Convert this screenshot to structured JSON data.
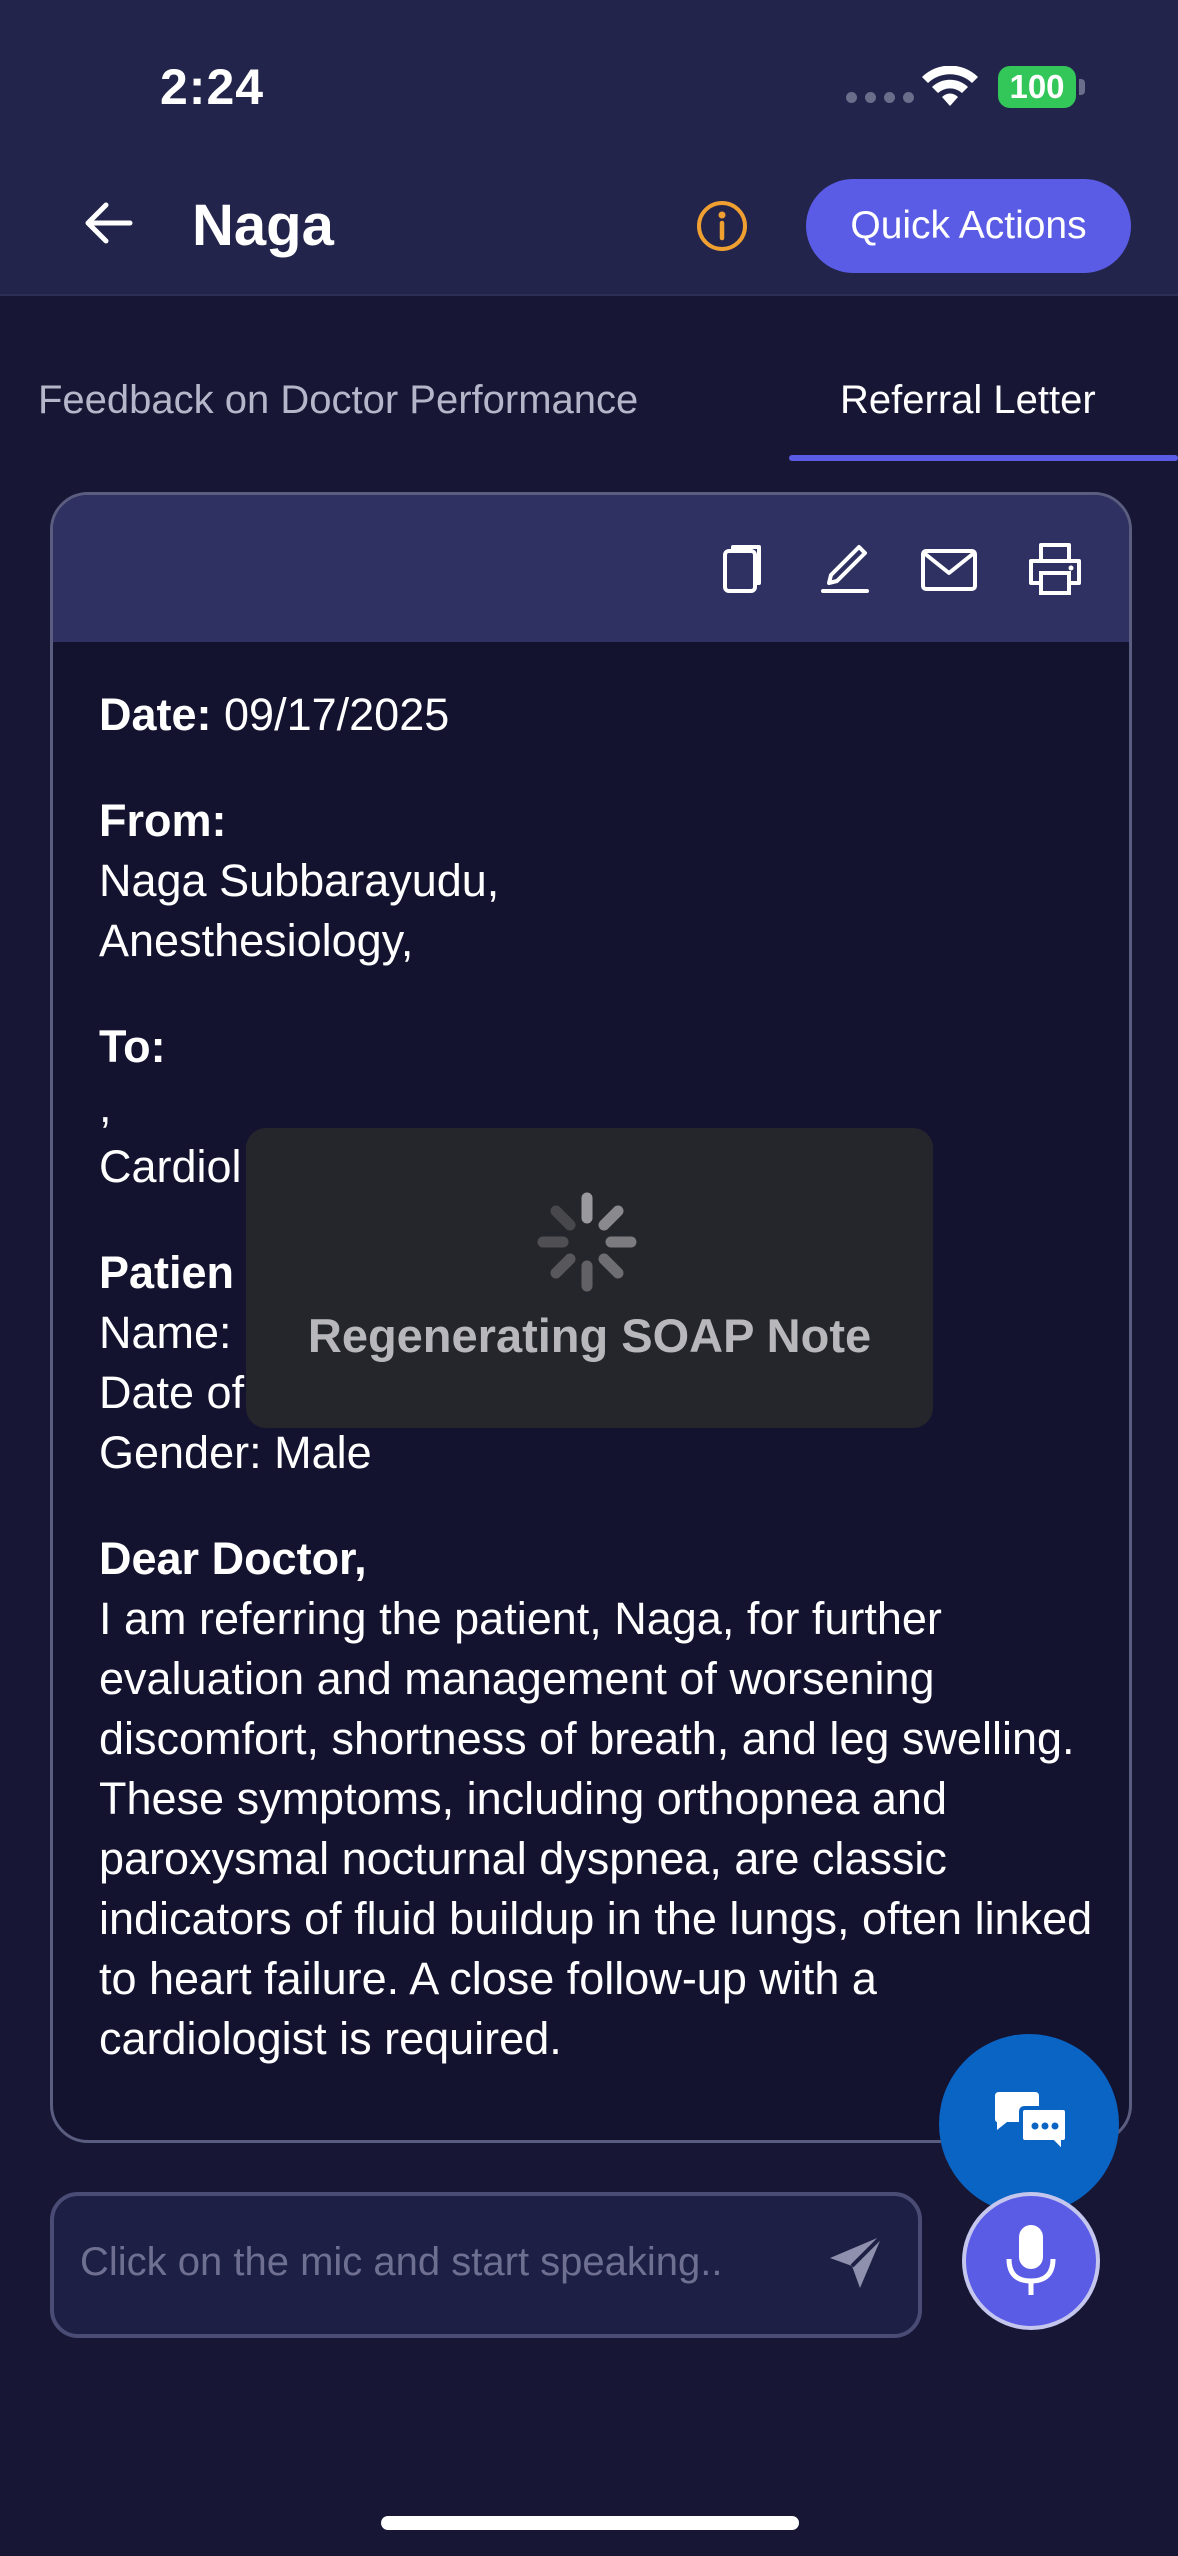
{
  "status_bar": {
    "time": "2:24",
    "battery": "100"
  },
  "header": {
    "title": "Naga",
    "quick_actions": "Quick Actions"
  },
  "tabs": [
    {
      "label": "Feedback on Doctor Performance"
    },
    {
      "label": "Referral Letter"
    }
  ],
  "letter": {
    "date_label": "Date:",
    "date_value": " 09/17/2025",
    "from_label": "From:",
    "from_name": "Naga Subbarayudu,",
    "from_dept": "Anesthesiology,",
    "to_label": "To:",
    "to_name": ",",
    "to_dept": "Cardiol",
    "patient_label": "Patien",
    "patient_name": "Name:",
    "patient_dob": "Date of",
    "patient_gender": "Gender: Male",
    "salutation": "Dear Doctor,",
    "body": "I am referring the patient, Naga, for further evaluation and management of worsening discomfort, shortness of breath, and leg swelling. These symptoms, including orthopnea and paroxysmal nocturnal dyspnea, are classic indicators of fluid buildup in the lungs, often linked to heart failure. A close follow-up with a cardiologist is required."
  },
  "overlay": {
    "text": "Regenerating SOAP Note"
  },
  "input": {
    "placeholder": "Click on the mic and start speaking.."
  },
  "colors": {
    "accent": "#5b5ce6",
    "background": "#171735",
    "battery": "#33c759",
    "chat_fab": "#0a64c4",
    "info": "#f0a030"
  }
}
